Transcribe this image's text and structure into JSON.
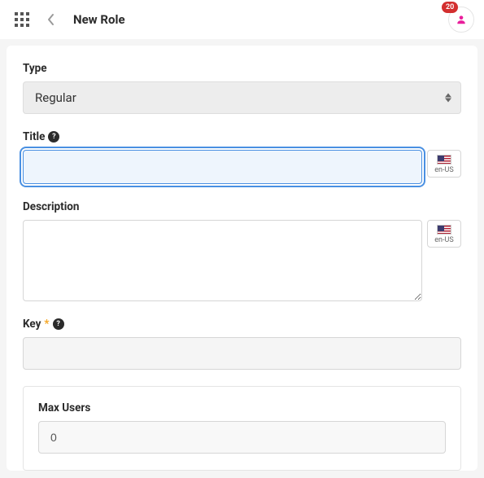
{
  "header": {
    "title": "New Role",
    "badge_count": "20"
  },
  "form": {
    "type": {
      "label": "Type",
      "value": "Regular"
    },
    "title": {
      "label": "Title",
      "value": "",
      "help": "?",
      "locale": "en-US"
    },
    "description": {
      "label": "Description",
      "value": "",
      "locale": "en-US"
    },
    "key": {
      "label": "Key",
      "value": "",
      "required_mark": "*",
      "help": "?"
    },
    "max_users": {
      "label": "Max Users",
      "value": "0"
    }
  }
}
